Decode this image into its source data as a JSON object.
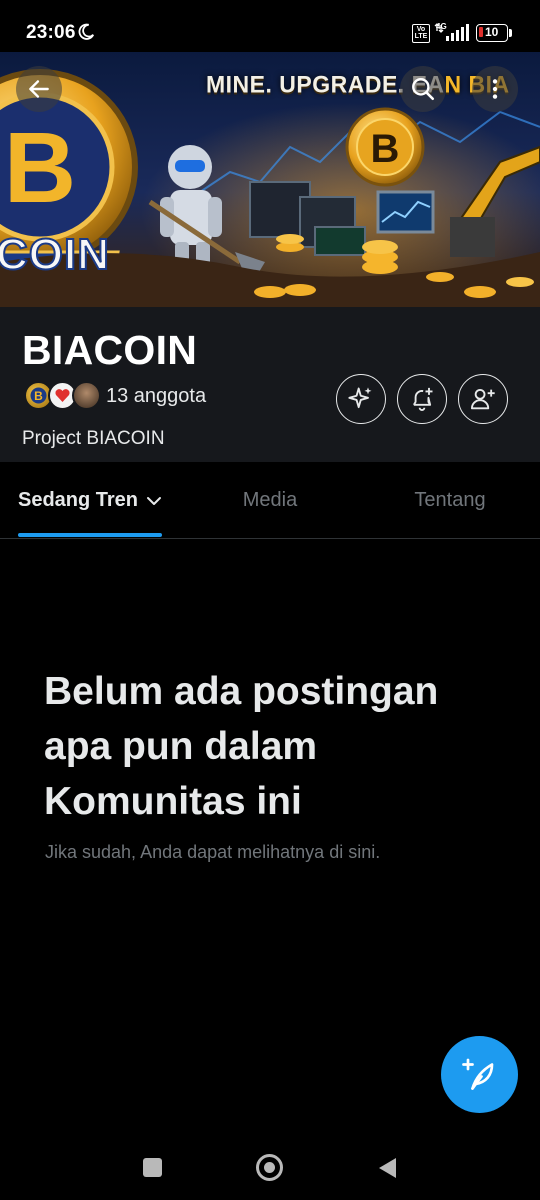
{
  "status_bar": {
    "time": "23:06",
    "volte_label": "Vo LTE",
    "network_type": "4G",
    "battery_level": "10",
    "icons": [
      "moon-icon",
      "volte-icon",
      "signal-icon",
      "battery-icon"
    ]
  },
  "banner": {
    "slogan_main": "MINE. UPGRADE. EA",
    "slogan_accent": "N BIA",
    "coin_text": "COIN",
    "icons": [
      "back-arrow-icon",
      "search-icon",
      "more-vertical-icon"
    ]
  },
  "community": {
    "name": "BIACOIN",
    "member_count": "13 anggota",
    "description": "Project BIACOIN",
    "actions": [
      "sparkle-icon",
      "bell-plus-icon",
      "add-person-icon"
    ]
  },
  "tabs": [
    {
      "label": "Sedang Tren",
      "active": true
    },
    {
      "label": "Media",
      "active": false
    },
    {
      "label": "Tentang",
      "active": false
    }
  ],
  "empty_state": {
    "title": "Belum ada postingan apa pun dalam Komunitas ini",
    "subtitle": "Jika sudah, Anda dapat melihatnya di sini."
  },
  "colors": {
    "accent": "#1d9bf0",
    "background": "#000000",
    "header_bg": "#16181c",
    "muted_text": "#71767b",
    "battery_low": "#e0302d"
  },
  "fab": {
    "icon": "compose-feather-plus-icon"
  },
  "nav_bar": {
    "icons": [
      "recent-apps-icon",
      "home-icon",
      "nav-back-icon"
    ]
  }
}
